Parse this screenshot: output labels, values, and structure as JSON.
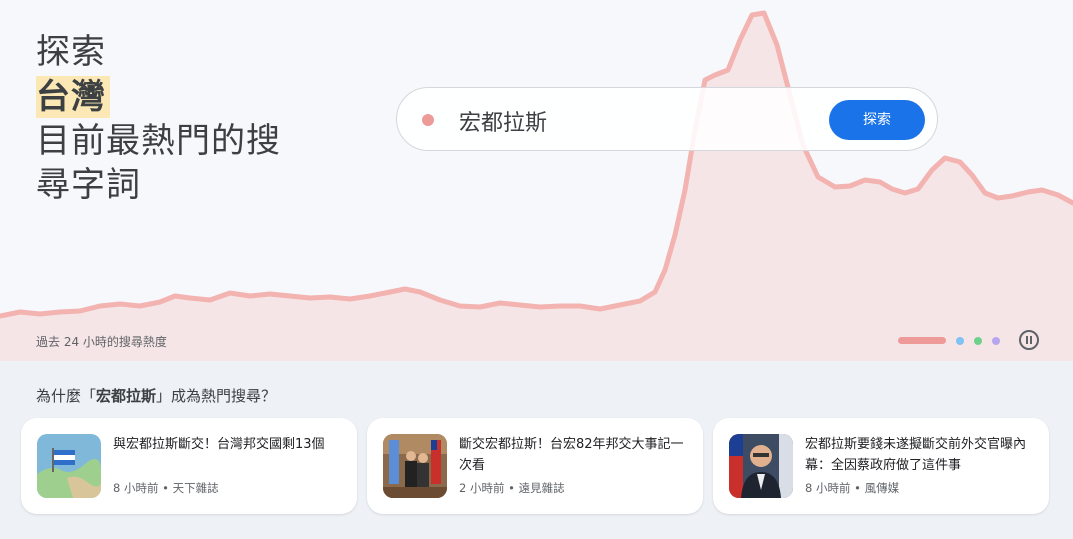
{
  "hero": {
    "headline": [
      "探索",
      "台灣",
      "目前最熱門的搜",
      "尋字詞"
    ],
    "chart_caption": "過去 24 小時的搜尋熱度",
    "accent_color": "#ee9a98"
  },
  "search": {
    "term": "宏都拉斯",
    "button_label": "探索"
  },
  "carousel": {
    "active_color": "#ee9a98",
    "dot_colors": [
      "#7ec3f4",
      "#6fd08c",
      "#b7a6ee"
    ]
  },
  "why": {
    "prefix": "為什麼「",
    "term": "宏都拉斯",
    "suffix": "」成為熱門搜尋？"
  },
  "articles": [
    {
      "title": "與宏都拉斯斷交！台灣邦交國剩13個",
      "time": "8 小時前",
      "source": "天下雜誌"
    },
    {
      "title": "斷交宏都拉斯！台宏82年邦交大事記一次看",
      "time": "2 小時前",
      "source": "遠見雜誌"
    },
    {
      "title": "宏都拉斯要錢未遂擬斷交前外交官曝內幕：全因蔡政府做了這件事",
      "time": "8 小時前",
      "source": "風傳媒"
    }
  ],
  "meta_separator": "•"
}
